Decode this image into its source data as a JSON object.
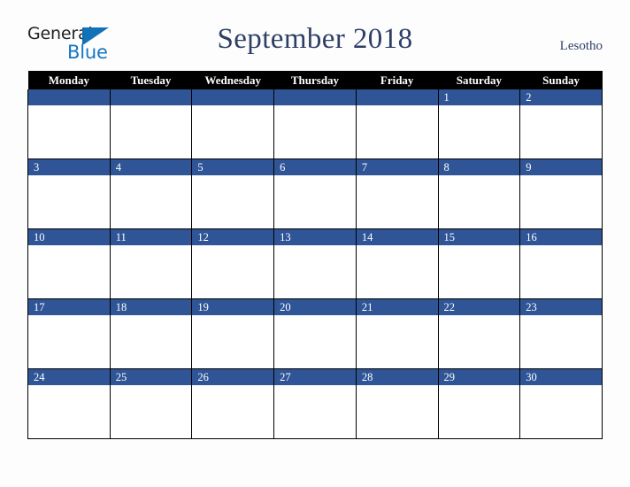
{
  "brand": {
    "name_part1": "General",
    "name_part2": "Blue",
    "triangle_icon": "triangle-icon",
    "accent_color": "#1577c4"
  },
  "header": {
    "title": "September 2018",
    "country": "Lesotho",
    "title_color": "#2e3f66"
  },
  "calendar": {
    "month": "September",
    "year": "2018",
    "weekday_headers": [
      "Monday",
      "Tuesday",
      "Wednesday",
      "Thursday",
      "Friday",
      "Saturday",
      "Sunday"
    ],
    "header_bg": "#000000",
    "daynum_bg": "#2f5597",
    "daynum_color": "#ffffff",
    "weeks": [
      [
        "",
        "",
        "",
        "",
        "",
        "1",
        "2"
      ],
      [
        "3",
        "4",
        "5",
        "6",
        "7",
        "8",
        "9"
      ],
      [
        "10",
        "11",
        "12",
        "13",
        "14",
        "15",
        "16"
      ],
      [
        "17",
        "18",
        "19",
        "20",
        "21",
        "22",
        "23"
      ],
      [
        "24",
        "25",
        "26",
        "27",
        "28",
        "29",
        "30"
      ]
    ]
  }
}
